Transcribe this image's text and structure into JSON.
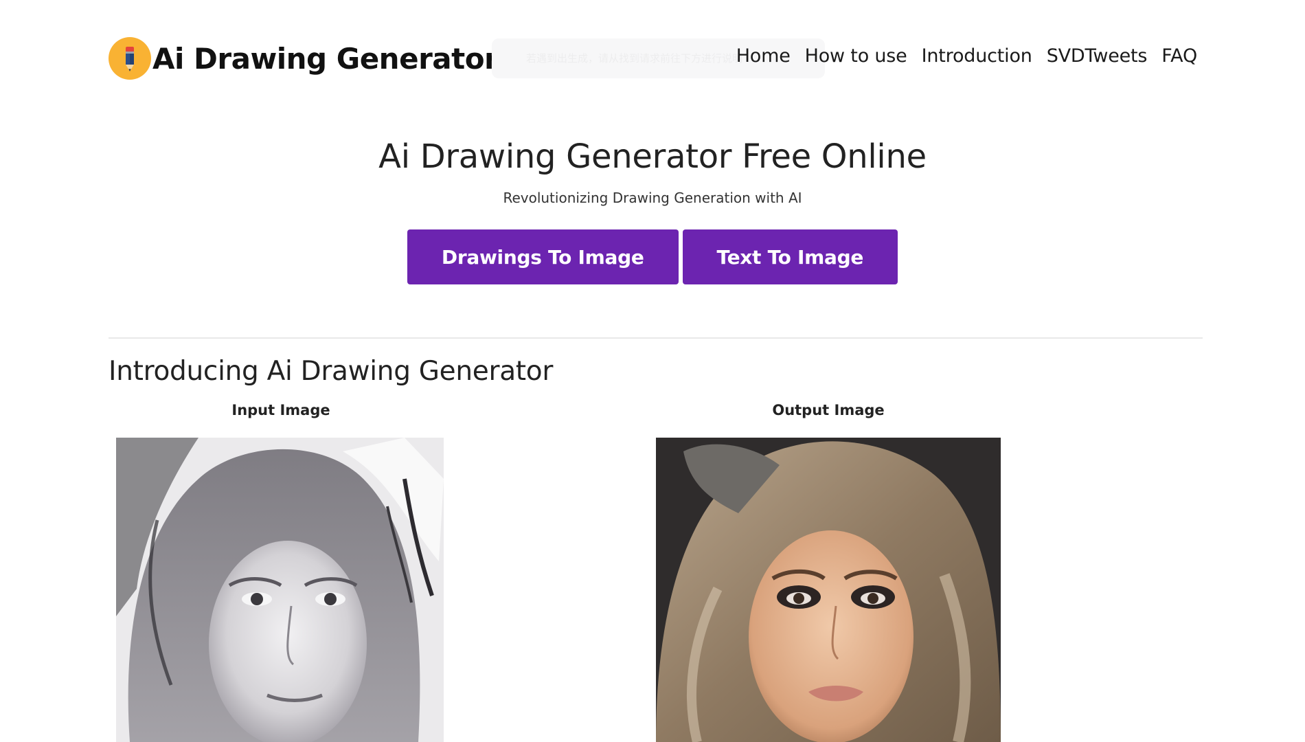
{
  "header": {
    "brand_name": "Ai Drawing Generator",
    "logo_icon": "pencil-icon",
    "notice_text": "若遇到出生成，请从找到请求前往下方进行说明",
    "nav": [
      {
        "label": "Home"
      },
      {
        "label": "How to use"
      },
      {
        "label": "Introduction"
      },
      {
        "label": "SVDTweets"
      },
      {
        "label": "FAQ"
      }
    ]
  },
  "hero": {
    "title": "Ai Drawing Generator Free Online",
    "subtitle": "Revolutionizing Drawing Generation with AI",
    "buttons": [
      {
        "label": "Drawings To Image"
      },
      {
        "label": "Text To Image"
      }
    ]
  },
  "intro": {
    "title": "Introducing Ai Drawing Generator",
    "input_label": "Input Image",
    "output_label": "Output Image"
  },
  "colors": {
    "accent": "#6c24b0",
    "logo_bg": "#f9b233"
  }
}
